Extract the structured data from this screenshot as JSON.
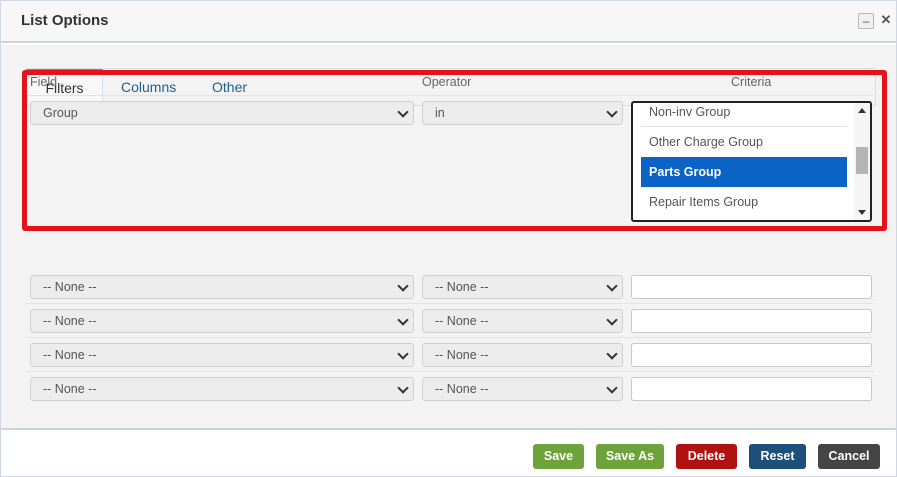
{
  "dialog": {
    "title": "List Options"
  },
  "tabs": [
    {
      "label": "Filters"
    },
    {
      "label": "Columns"
    },
    {
      "label": "Other"
    }
  ],
  "columns": {
    "field": "Field",
    "operator": "Operator",
    "criteria": "Criteria"
  },
  "filter_rows": [
    {
      "field": "Group",
      "operator": "in"
    },
    {
      "field": "-- None --",
      "operator": "-- None --"
    },
    {
      "field": "-- None --",
      "operator": "-- None --"
    },
    {
      "field": "-- None --",
      "operator": "-- None --"
    },
    {
      "field": "-- None --",
      "operator": "-- None --"
    }
  ],
  "criteria_list": {
    "options": [
      "Non-inv Group",
      "Other Charge Group",
      "Parts Group",
      "Repair Items Group"
    ],
    "selected": "Parts Group"
  },
  "buttons": {
    "save": "Save",
    "save_as": "Save As",
    "delete": "Delete",
    "reset": "Reset",
    "cancel": "Cancel"
  },
  "colors": {
    "accent_green": "#6ea23a",
    "delete_red": "#b01212",
    "reset_blue": "#1d4f7c",
    "cancel_gray": "#454545",
    "selection_blue": "#0b63c5",
    "highlight_red": "#e5121c"
  },
  "icons": {
    "minimize": "minimize-icon",
    "close": "close-icon",
    "dropdown": "chevron-down-icon"
  }
}
